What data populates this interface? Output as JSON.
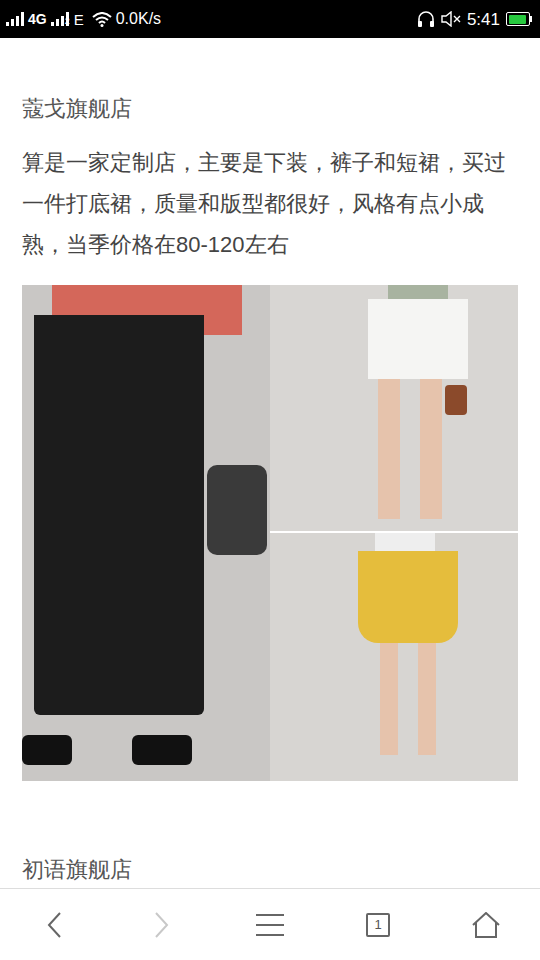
{
  "status_bar": {
    "network": "4G",
    "sim2": "2",
    "data_type": "E",
    "speed": "0.0K/s",
    "time": "5:41",
    "battery_level": 0.9
  },
  "article": {
    "sections": [
      {
        "title": "蔻戈旗舰店",
        "text": "算是一家定制店，主要是下装，裤子和短裙，买过一件打底裙，质量和版型都很好，风格有点小成熟，当季价格在80-120左右"
      }
    ],
    "next_title": "初语旗舰店"
  },
  "bottom_nav": {
    "items": [
      {
        "kind": "back",
        "disabled": false
      },
      {
        "kind": "forward",
        "disabled": true
      },
      {
        "kind": "menu",
        "disabled": false
      },
      {
        "kind": "tabs",
        "disabled": false
      },
      {
        "kind": "home",
        "disabled": false
      }
    ],
    "tab_count": "1"
  }
}
